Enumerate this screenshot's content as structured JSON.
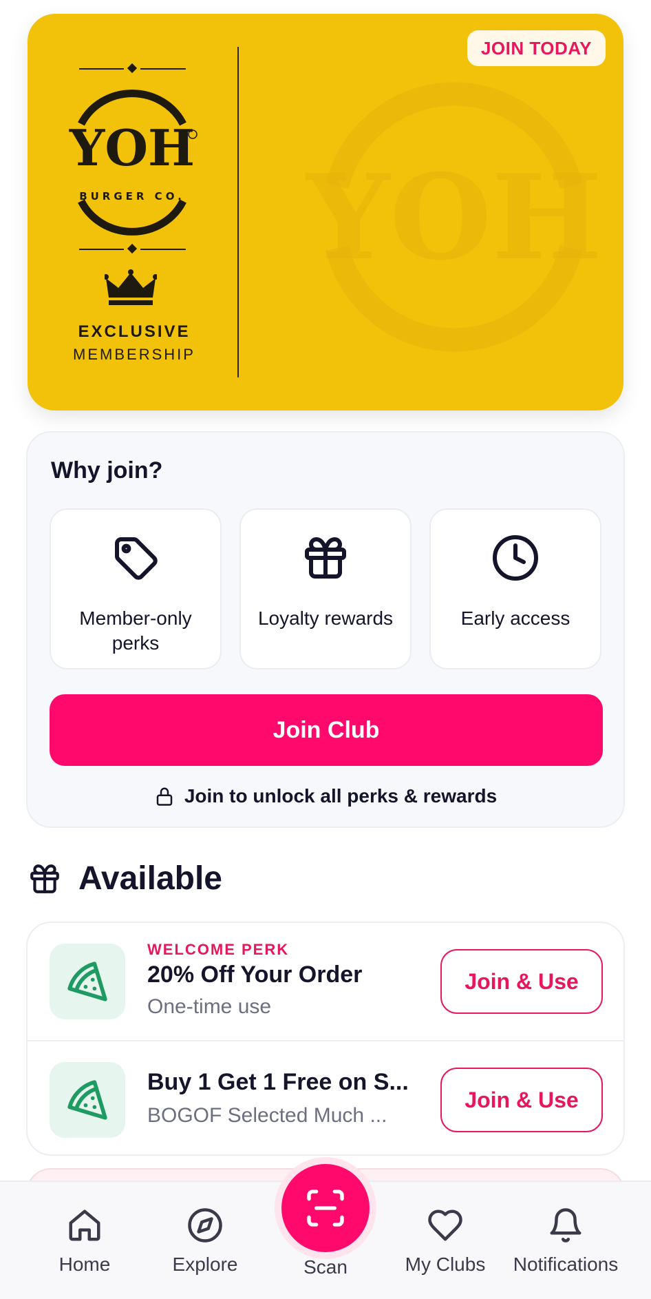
{
  "card": {
    "badge": "JOIN TODAY",
    "logo_text": "YOH",
    "logo_sub": "BURGER CO.",
    "tier_line1": "EXCLUSIVE",
    "tier_line2": "MEMBERSHIP",
    "colors": {
      "background": "#f2c10a",
      "badge_text": "#e8175d"
    }
  },
  "why_join": {
    "title": "Why join?",
    "features": [
      {
        "icon": "tag-icon",
        "label": "Member-only perks"
      },
      {
        "icon": "gift-icon",
        "label": "Loyalty rewards"
      },
      {
        "icon": "clock-icon",
        "label": "Early access"
      }
    ],
    "cta": "Join Club",
    "unlock_note": "Join to unlock all perks & rewards"
  },
  "available": {
    "title": "Available",
    "items": [
      {
        "eyebrow": "WELCOME PERK",
        "title": "20% Off Your Order",
        "subtitle": "One-time use",
        "action": "Join & Use",
        "icon": "pizza-icon"
      },
      {
        "eyebrow": "",
        "title": "Buy 1 Get 1 Free on S...",
        "subtitle": "BOGOF Selected Much ...",
        "action": "Join & Use",
        "icon": "pizza-icon"
      }
    ]
  },
  "nav": {
    "items": [
      {
        "label": "Home",
        "icon": "home-icon"
      },
      {
        "label": "Explore",
        "icon": "compass-icon"
      },
      {
        "label": "Scan",
        "icon": "scan-icon"
      },
      {
        "label": "My Clubs",
        "icon": "heart-icon"
      },
      {
        "label": "Notifications",
        "icon": "bell-icon"
      }
    ]
  },
  "theme": {
    "accent": "#ff0a6c",
    "text": "#14142b",
    "muted": "#6b6f80"
  }
}
